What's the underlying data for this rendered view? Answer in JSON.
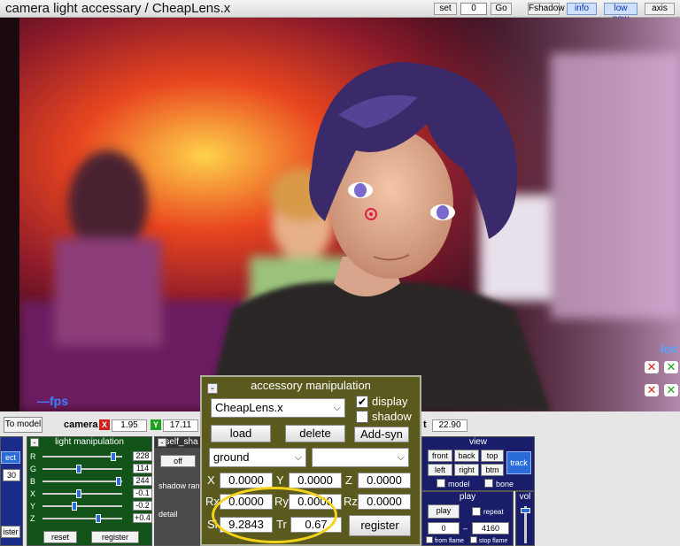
{
  "titlebar": {
    "title": "camera light accessary / CheapLens.x",
    "set_label": "set",
    "frame_value": "0",
    "go_label": "Go",
    "fshadow_label": "Fshadow",
    "info_label": "info",
    "lowpow_label": "low pow",
    "axis_label": "axis"
  },
  "viewport": {
    "fps_label": "—fps",
    "loc_label": "loc"
  },
  "coords": {
    "to_model_label": "To model",
    "camera_label": "camera",
    "x_axis": "X",
    "x_value": "1.95",
    "y_axis": "Y",
    "y_value": "17.11",
    "t_suffix": "t",
    "t_value": "22.90"
  },
  "left_panel": {
    "select_label": "ect",
    "value": "30",
    "register_label": "ister"
  },
  "light": {
    "header": "light manipulation",
    "sliders": [
      {
        "label": "R",
        "value": "228",
        "level": 0.89
      },
      {
        "label": "G",
        "value": "114",
        "level": 0.45
      },
      {
        "label": "B",
        "value": "244",
        "level": 0.96
      },
      {
        "label": "X",
        "value": "-0.1",
        "level": 0.45
      },
      {
        "label": "Y",
        "value": "-0.2",
        "level": 0.4
      },
      {
        "label": "Z",
        "value": "+0.4",
        "level": 0.7
      }
    ],
    "reset_label": "reset",
    "register_label": "register"
  },
  "shadow": {
    "header": "self_sha",
    "off_label": "off",
    "range_label": "shadow ran",
    "detail_label": "detail"
  },
  "accessory": {
    "header": "accessory manipulation",
    "file": "CheapLens.x",
    "display_label": "display",
    "display_checked": "✔",
    "shadow_label": "shadow",
    "load_label": "load",
    "delete_label": "delete",
    "addsyn_label": "Add-syn",
    "parent": "ground",
    "bone": "",
    "x_label": "X",
    "x_value": "0.0000",
    "y_label": "Y",
    "y_value": "0.0000",
    "z_label": "Z",
    "z_value": "0.0000",
    "rx_label": "Rx",
    "rx_value": "0.0000",
    "ry_label": "Ry",
    "ry_value": "0.0000",
    "rz_label": "Rz",
    "rz_value": "0.0000",
    "si_label": "Si",
    "si_value": "9.2843",
    "tr_label": "Tr",
    "tr_value": "0.67",
    "register_label": "register"
  },
  "view": {
    "header": "view",
    "front": "front",
    "back": "back",
    "top": "top",
    "left": "left",
    "right": "right",
    "btm": "btm",
    "track": "track",
    "model": "model",
    "bone": "bone"
  },
  "play": {
    "header": "play",
    "play_label": "play",
    "repeat_label": "repeat",
    "from_value": "0",
    "dash": "–",
    "to_value": "4160",
    "from_flame": "from flame",
    "stop_flame": "stop flame"
  },
  "vol": {
    "header": "vol"
  },
  "colors": {
    "accent_blue": "#2a6dd8",
    "panel_green": "#12531a",
    "panel_blue": "#1a1e6a",
    "dialog_olive": "#5a5a1e",
    "highlight_yellow": "#f3d21a"
  }
}
